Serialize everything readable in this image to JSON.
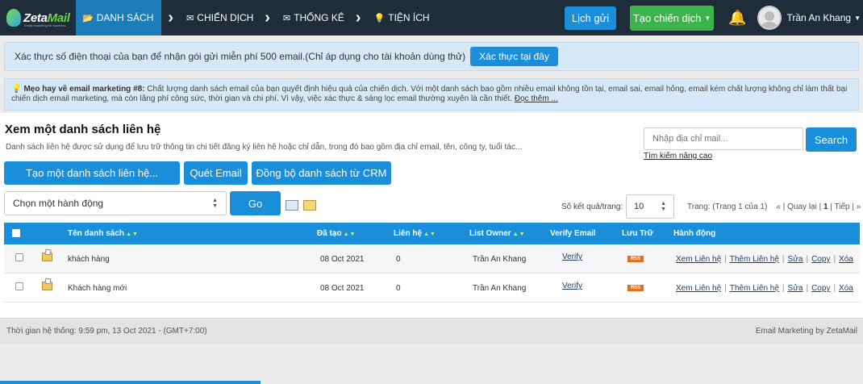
{
  "brand": {
    "name_a": "Zeta",
    "name_b": "Mail",
    "tagline": "Email marketing for business"
  },
  "nav": {
    "items": [
      {
        "label": "DANH SÁCH",
        "icon": "folder-icon"
      },
      {
        "label": "CHIẾN DỊCH",
        "icon": "envelope-icon"
      },
      {
        "label": "THỐNG KÊ",
        "icon": "envelope-icon"
      },
      {
        "label": "TIỆN ÍCH",
        "icon": "lightbulb-icon"
      }
    ],
    "schedule_label": "Lịch gửi",
    "create_campaign_label": "Tạo chiến dịch",
    "user_name": "Trần An Khang"
  },
  "alert_phone": {
    "text": "Xác thực số điện thoại của bạn để nhận gói gửi miễn phí 500 email.(Chỉ áp dụng cho tài khoản dùng thử)",
    "button": "Xác thực tại đây"
  },
  "tip": {
    "title": "Mẹo hay về email marketing #8:",
    "text": " Chất lượng danh sách email của bạn quyết định hiệu quả của chiến dịch. Với một danh sách bao gồm nhiều email không tồn tại, email sai, email hỏng, email kém chất lượng không chỉ làm thất bại chiến dịch email marketing, mà còn lãng phí công sức, thời gian và chi phí. Vì vậy, việc xác thực & sàng lọc email thường xuyên là cần thiết. ",
    "more": "Đọc thêm ..."
  },
  "page": {
    "title": "Xem một danh sách liên hệ",
    "description": "Danh sách liên hệ được sử dụng để lưu trữ thông tin chi tiết đăng ký liên hệ hoặc chỉ dẫn, trong đó bao gồm địa chỉ email, tên, công ty, tuổi tác..."
  },
  "search": {
    "placeholder": "Nhập địa chỉ mail...",
    "button": "Search",
    "advanced": "Tìm kiếm nâng cao"
  },
  "actions": {
    "create_list": "Tạo một danh sách liên hệ...",
    "scan_email": "Quét Email",
    "sync_crm": "Đồng bộ danh sách từ CRM",
    "select_action": "Chọn một hành động",
    "go": "Go"
  },
  "paging": {
    "per_page_label": "Số kết quả/trang:",
    "per_page_value": "10",
    "page_info": "Trang: (Trang 1 của 1)",
    "back": "« | Quay lại |",
    "current": "1",
    "next": "| Tiếp | »"
  },
  "table": {
    "headers": {
      "name": "Tên danh sách",
      "created": "Đã tạo",
      "contacts": "Liên hệ",
      "owner": "List Owner",
      "verify": "Verify Email",
      "archive": "Lưu Trữ",
      "actions": "Hành động"
    },
    "sort_glyph": "▲▼",
    "rss_label": "RSS",
    "rows": [
      {
        "name": "khách hàng",
        "created": "08 Oct 2021",
        "contacts": "0",
        "owner": "Trần An Khang",
        "verify": "Verify"
      },
      {
        "name": "Khách hàng mới",
        "created": "08 Oct 2021",
        "contacts": "0",
        "owner": "Trần An Khang",
        "verify": "Verify"
      }
    ],
    "row_actions": [
      "Xem Liên hệ",
      "Thêm Liên hệ",
      "Sửa",
      "Copy",
      "Xóa"
    ]
  },
  "footer": {
    "time": "Thời gian hệ thống: 9:59 pm, 13 Oct 2021 - (GMT+7:00)",
    "credit": "Email Marketing by ZetaMail"
  },
  "colors": {
    "nav_bg": "#1f2d3a",
    "accent": "#1a8ed8",
    "green": "#3bb54a",
    "alert_bg": "#d7e9f8"
  }
}
